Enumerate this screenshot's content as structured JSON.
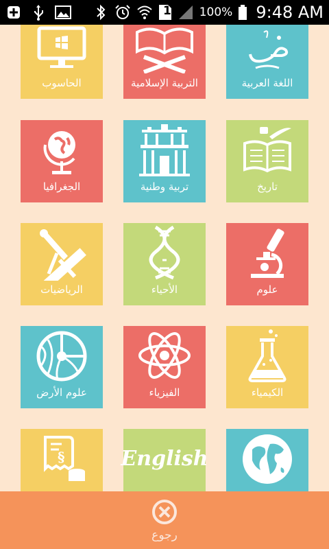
{
  "status_bar": {
    "battery_percent": "100%",
    "time": "9:48 AM",
    "sim_slot": "1",
    "icons": [
      "add-notification-icon",
      "usb-icon",
      "image-icon",
      "bluetooth-icon",
      "alarm-icon",
      "wifi-icon",
      "sim-icon",
      "signal-icon",
      "battery-icon"
    ]
  },
  "tiles": [
    {
      "label": "الحاسوب",
      "icon": "computer-icon",
      "color": "#f5cf63"
    },
    {
      "label": "التربية الإسلامية",
      "icon": "quran-icon",
      "color": "#ec6e67"
    },
    {
      "label": "اللغة العربية",
      "icon": "arabic-letter-icon",
      "color": "#5ec2cb"
    },
    {
      "label": "الجغرافيا",
      "icon": "globe-stand-icon",
      "color": "#ec6e67"
    },
    {
      "label": "تربية وطنية",
      "icon": "petra-icon",
      "color": "#5ec2cb"
    },
    {
      "label": "تاريخ",
      "icon": "book-quill-icon",
      "color": "#c3d97a"
    },
    {
      "label": "الرياضيات",
      "icon": "ruler-compass-icon",
      "color": "#f5cf63"
    },
    {
      "label": "الأحياء",
      "icon": "dna-icon",
      "color": "#c3d97a"
    },
    {
      "label": "علوم",
      "icon": "microscope-icon",
      "color": "#ec6e67"
    },
    {
      "label": "علوم الأرض",
      "icon": "earth-layers-icon",
      "color": "#5ec2cb"
    },
    {
      "label": "الفيزياء",
      "icon": "atom-icon",
      "color": "#ec6e67"
    },
    {
      "label": "الكيمياء",
      "icon": "flask-icon",
      "color": "#f5cf63"
    },
    {
      "label": "",
      "icon": "receipt-coins-icon",
      "color": "#f5cf63"
    },
    {
      "label": "",
      "icon": "english-text-icon",
      "color": "#c3d97a",
      "art_text": "English"
    },
    {
      "label": "",
      "icon": "world-map-icon",
      "color": "#5ec2cb"
    }
  ],
  "bottom_bar": {
    "back_label": "رجوع",
    "icon": "close-circle-icon",
    "color": "#f5935a"
  }
}
